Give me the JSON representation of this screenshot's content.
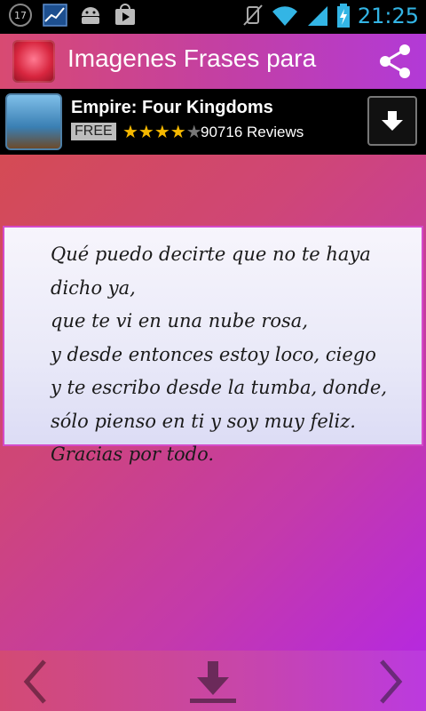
{
  "status_bar": {
    "notification_count": "17",
    "time": "21:25",
    "icons": [
      "notification-count-icon",
      "stock-chart-icon",
      "android-icon",
      "play-store-icon",
      "mute-icon",
      "wifi-icon",
      "signal-icon",
      "battery-charging-icon"
    ]
  },
  "titlebar": {
    "app_title": "Imagenes Frases para",
    "share_icon": "share-icon",
    "accent_color": "#c23fa6"
  },
  "ad": {
    "title": "Empire: Four Kingdoms",
    "price_label": "FREE",
    "rating_stars": 4,
    "reviews": "90716 Reviews",
    "download_icon": "download-arrow-icon"
  },
  "card": {
    "lines": [
      "Qué puedo decirte que no te haya dicho ya,",
      "que te vi en una nube rosa,",
      "y desde entonces estoy loco, ciego",
      "y te escribo desde la tumba, donde,",
      "sólo pienso en ti y soy muy feliz.",
      "Gracias por todo."
    ]
  },
  "bottom_nav": {
    "prev_icon": "chevron-left-icon",
    "download_icon": "download-icon",
    "next_icon": "chevron-right-icon"
  }
}
